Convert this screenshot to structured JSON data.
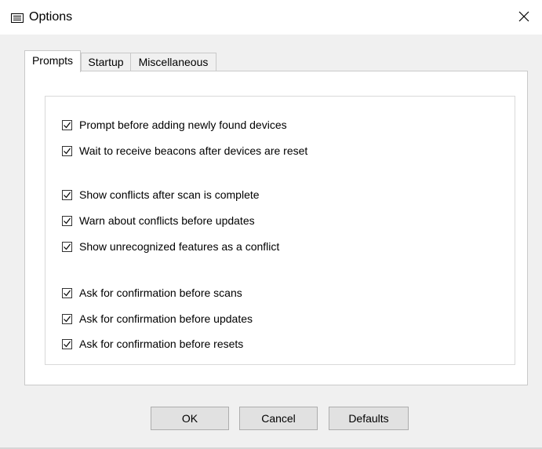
{
  "window": {
    "title": "Options",
    "icon": "window-menu-icon",
    "close_icon": "close-icon"
  },
  "tabs": [
    {
      "label": "Prompts",
      "active": true
    },
    {
      "label": "Startup",
      "active": false
    },
    {
      "label": "Miscellaneous",
      "active": false
    }
  ],
  "options": [
    {
      "label": "Prompt before adding newly found devices",
      "checked": true
    },
    {
      "label": "Wait to receive beacons after devices are reset",
      "checked": true
    },
    {
      "label": "Show conflicts after scan is complete",
      "checked": true
    },
    {
      "label": "Warn about conflicts before updates",
      "checked": true
    },
    {
      "label": "Show unrecognized features as a conflict",
      "checked": true
    },
    {
      "label": "Ask for confirmation before scans",
      "checked": true
    },
    {
      "label": "Ask for confirmation before updates",
      "checked": true
    },
    {
      "label": "Ask for confirmation before resets",
      "checked": true
    }
  ],
  "buttons": {
    "ok": "OK",
    "cancel": "Cancel",
    "defaults": "Defaults"
  }
}
